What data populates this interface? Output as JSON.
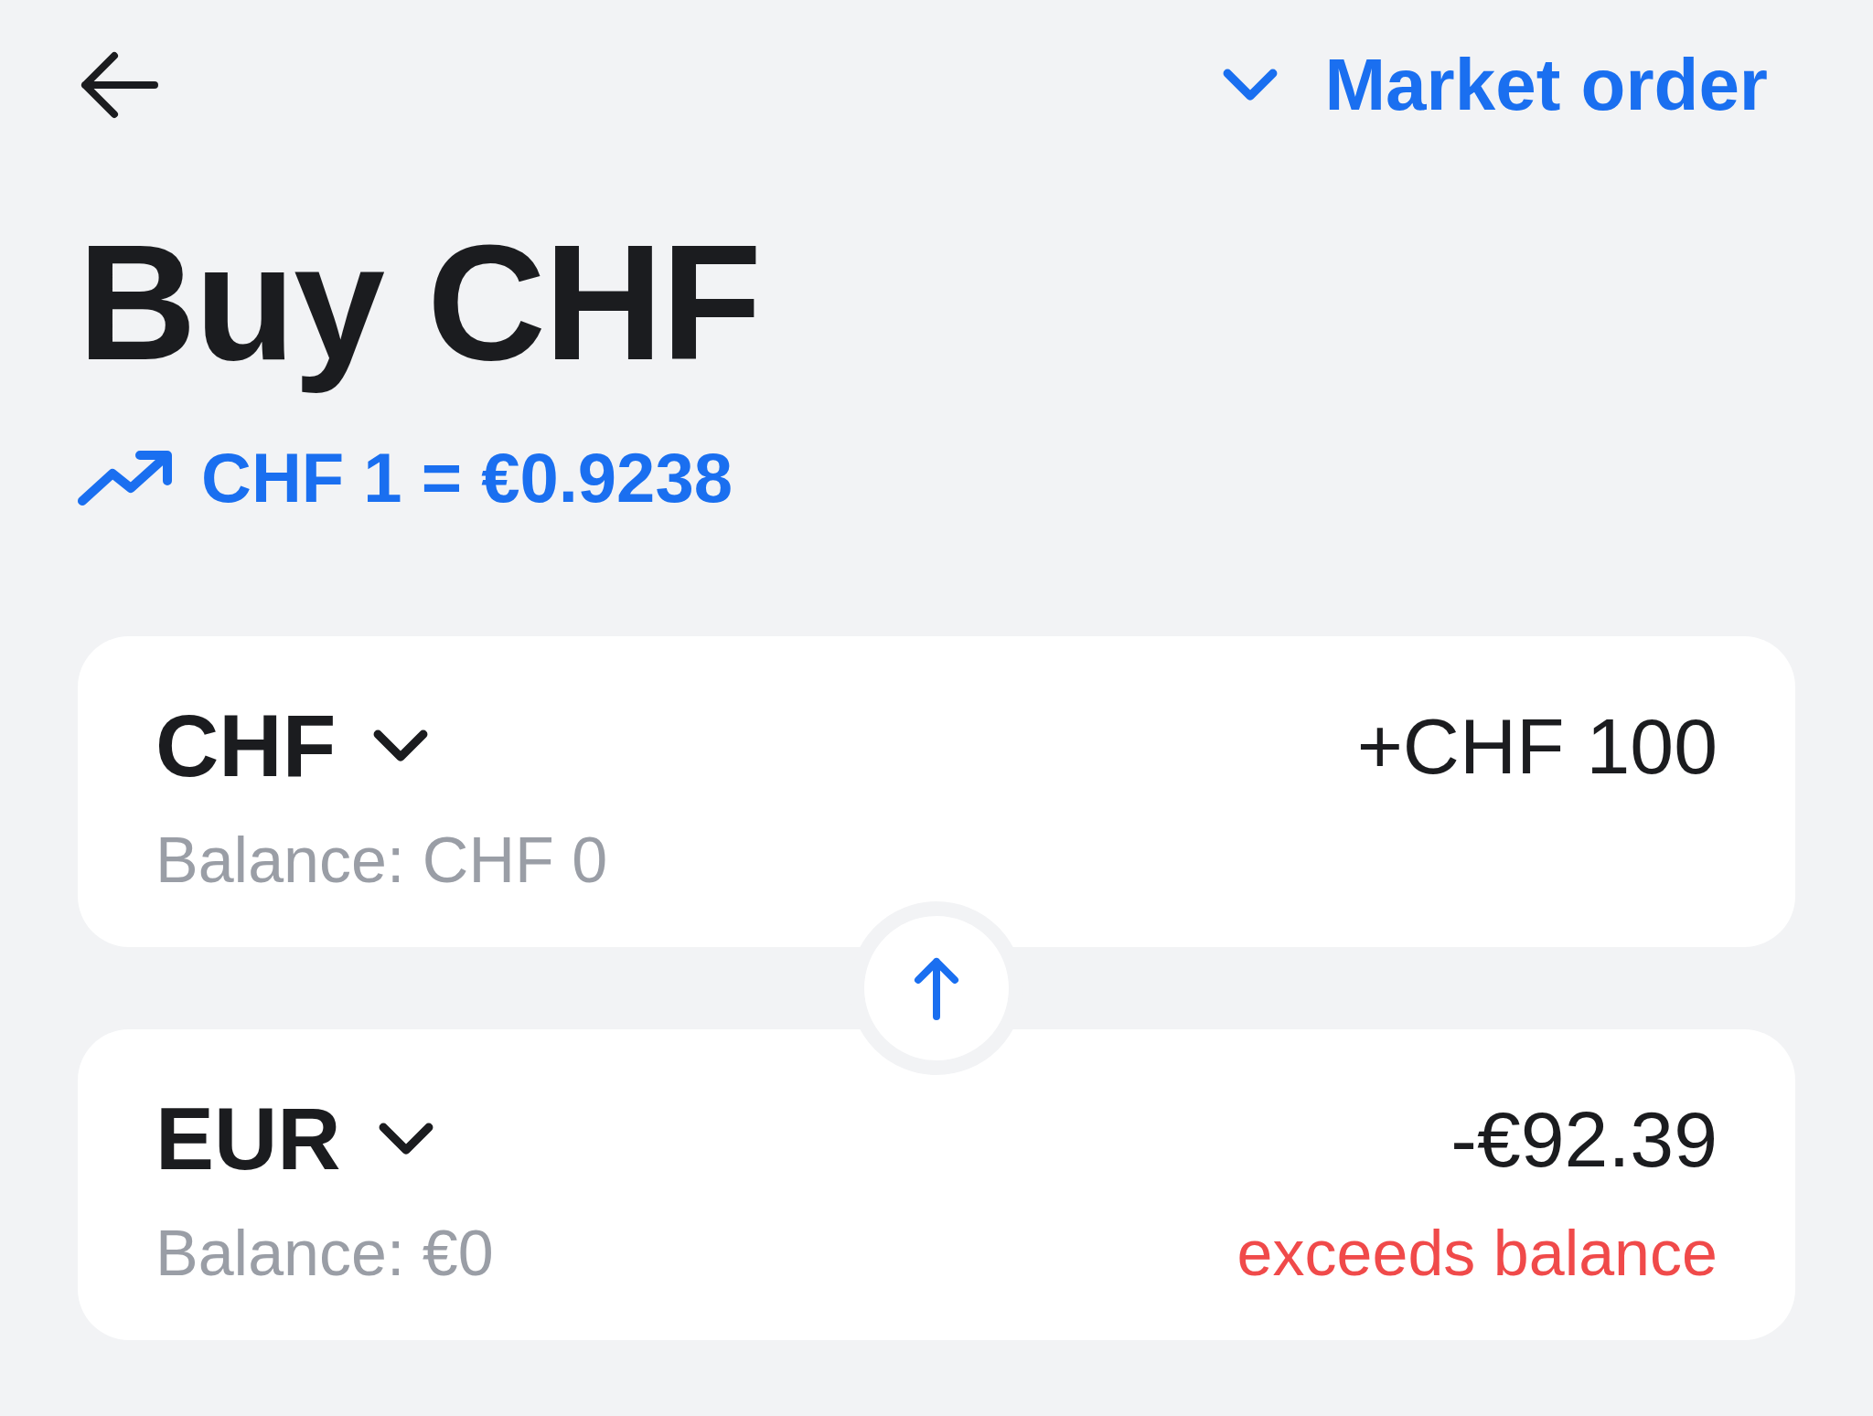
{
  "order_type": {
    "label": "Market order"
  },
  "title": "Buy CHF",
  "rate": "CHF 1 = €0.9238",
  "legs": [
    {
      "currency": "CHF",
      "amount": "+CHF 100",
      "balance": "Balance: CHF 0"
    },
    {
      "currency": "EUR",
      "amount": "-€92.39",
      "balance": "Balance: €0",
      "warning": "exceeds balance"
    }
  ]
}
